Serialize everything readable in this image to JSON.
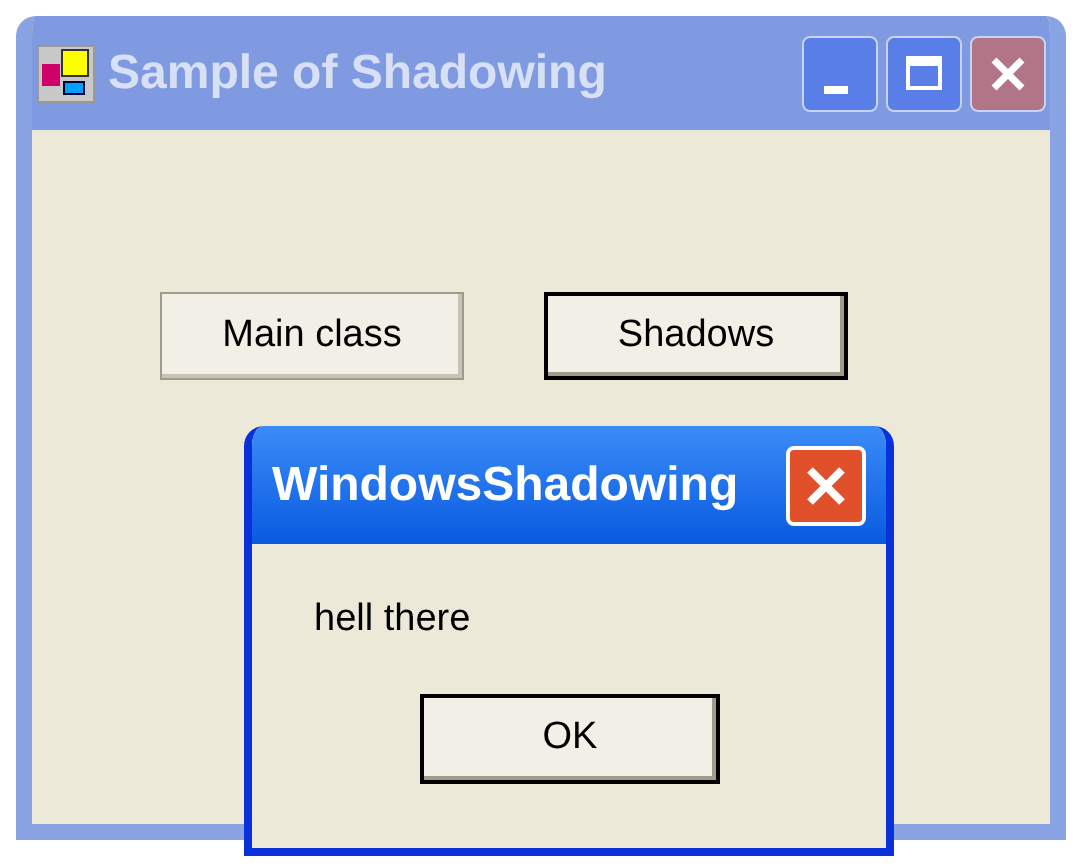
{
  "window": {
    "title": "Sample of Shadowing",
    "active": false,
    "controls": [
      {
        "kind": "minimize"
      },
      {
        "kind": "maximize"
      },
      {
        "kind": "close"
      }
    ]
  },
  "client": {
    "buttons": [
      {
        "label": "Main class",
        "focused": false
      },
      {
        "label": "Shadows",
        "focused": true
      }
    ]
  },
  "dialog": {
    "title": "WindowsShadowing",
    "active": true,
    "message": "hell there",
    "button": "OK"
  }
}
